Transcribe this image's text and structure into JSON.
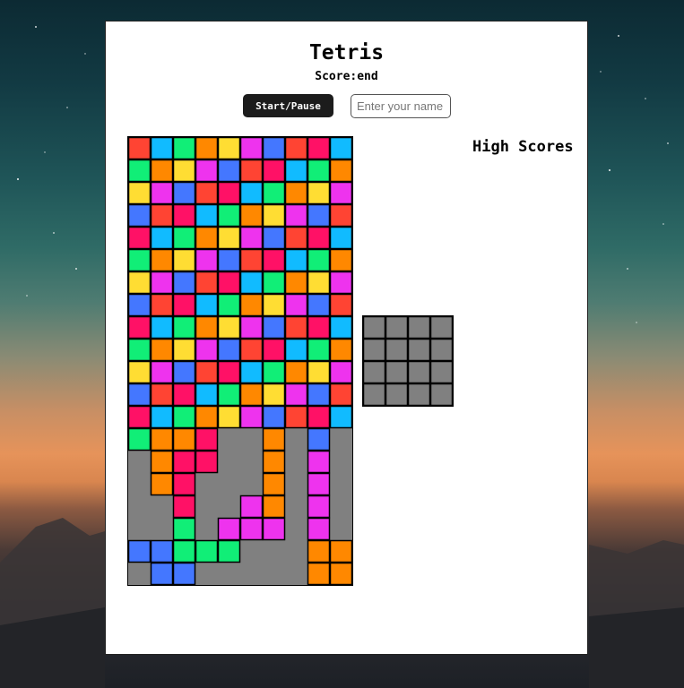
{
  "app": {
    "title": "Tetris",
    "score_text": "Score:end"
  },
  "controls": {
    "start_pause_label": "Start/Pause",
    "name_placeholder": "Enter your name"
  },
  "high_scores": {
    "title": "High Scores",
    "entries": []
  },
  "colors": {
    "cell_gray": "#808080",
    "palette": [
      "#ff3355",
      "#11bbff",
      "#11ee77",
      "#ff8800",
      "#ffdd33",
      "#ee33ee",
      "#4477ff",
      "#ff4433"
    ]
  },
  "board": {
    "cols": 10,
    "rows": 20,
    "cells": [
      "RCGOYMBRPC",
      "GOYMBRPCGO",
      "YMBRPCGOYM",
      "BRPCGOYMBR",
      "PCGOYMBRPC",
      "GOYMBRPCGO",
      "YMBRPCGOYM",
      "BRPCGOYMBR",
      "PCGOYMBRPC",
      "GOYMBRPCGO",
      "YMBRPCGOYM",
      "BRPCGOYMBR",
      "PCGOYMBRPC",
      "GOOP..O.B.",
      ".OPP..O.M.",
      ".OP...O.M.",
      "..P..MO.M.",
      "..G.MMM.M.",
      "BBGGG...OO",
      ".BB.....OO"
    ],
    "color_key": {
      "R": "#ff4433",
      "P": "#ff1166",
      "C": "#11bbff",
      "G": "#11ee77",
      "O": "#ff8800",
      "Y": "#ffdd33",
      "M": "#ee33ee",
      "B": "#4477ff"
    }
  },
  "next_piece": {
    "cols": 4,
    "rows": 4,
    "cells": [
      "....",
      "....",
      "....",
      "...."
    ]
  }
}
